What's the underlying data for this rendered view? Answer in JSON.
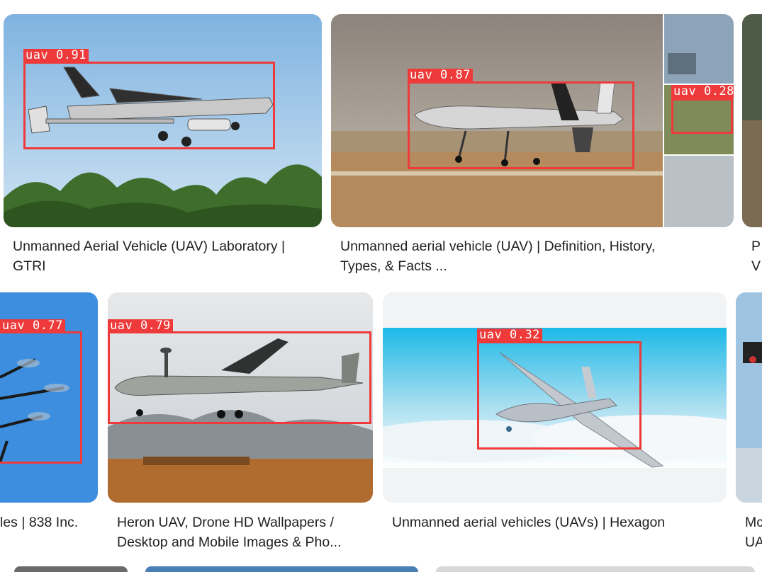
{
  "results": [
    {
      "id": "r1",
      "caption_lines": [
        "Unmanned Aerial Vehicle (UAV) Laboratory |",
        "GTRI"
      ],
      "detection": {
        "label": "uav",
        "score": "0.91"
      }
    },
    {
      "id": "r2",
      "caption_lines": [
        "Unmanned aerial vehicle (UAV) | Definition, History,",
        "Types, & Facts ..."
      ],
      "detection": {
        "label": "uav",
        "score": "0.87"
      },
      "inset_detection": {
        "label": "uav",
        "score": "0.28"
      }
    },
    {
      "id": "r3",
      "caption_lines": [
        "P",
        "V"
      ]
    },
    {
      "id": "r4",
      "caption_lines": [
        "les | 838 Inc."
      ],
      "detection": {
        "label": "uav",
        "score": "0.77"
      }
    },
    {
      "id": "r5",
      "caption_lines": [
        "Heron UAV, Drone HD Wallpapers /",
        "Desktop and Mobile Images & Pho..."
      ],
      "detection": {
        "label": "uav",
        "score": "0.79"
      }
    },
    {
      "id": "r6",
      "caption_lines": [
        "Unmanned aerial vehicles (UAVs) | Hexagon"
      ],
      "detection": {
        "label": "uav",
        "score": "0.32"
      }
    },
    {
      "id": "r7",
      "caption_lines": [
        "Mc",
        "UA"
      ]
    }
  ],
  "colors": {
    "detection_box": "#ee3a3a",
    "caption_text": "#202124",
    "background": "#ffffff"
  }
}
